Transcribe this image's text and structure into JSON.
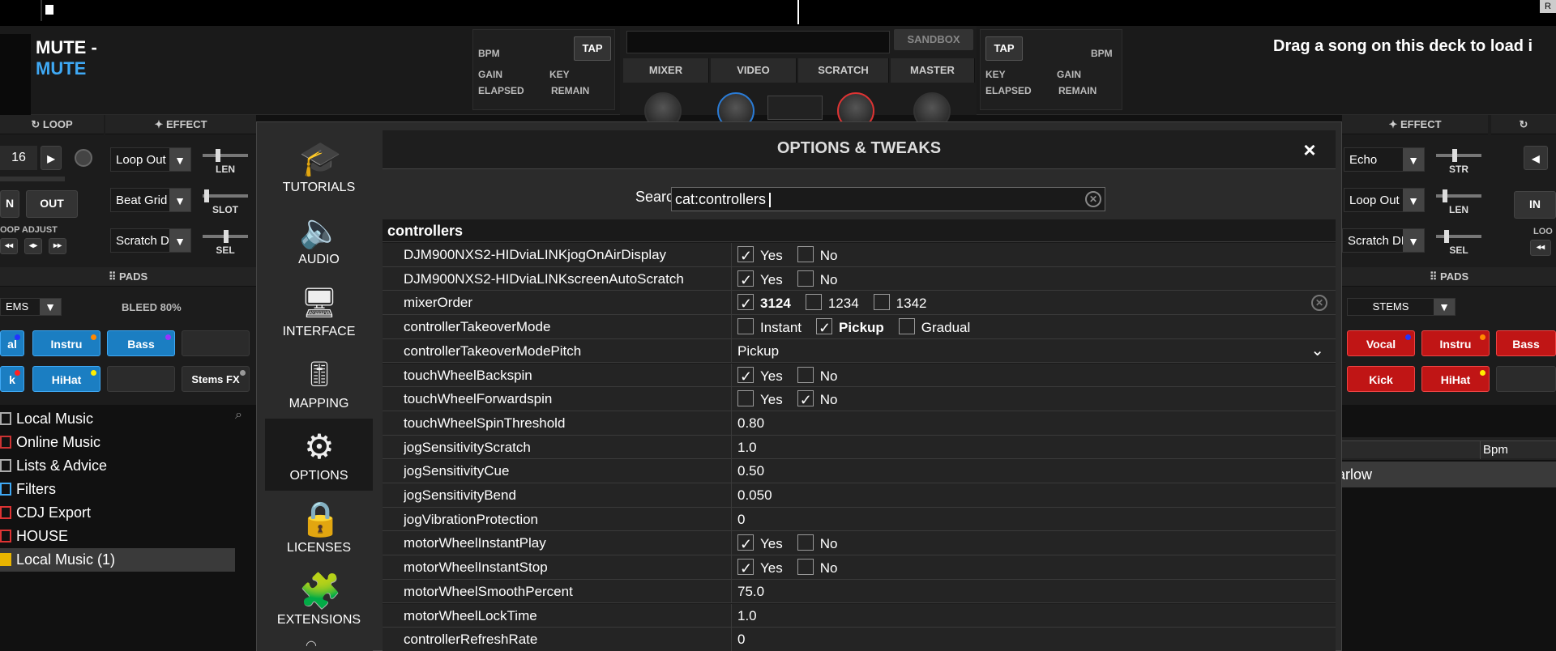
{
  "deck_left": {
    "title": "MUTE -",
    "subtitle": "MUTE",
    "bpm_label": "BPM",
    "tap_label": "TAP",
    "gain_label": "GAIN",
    "key_label": "KEY",
    "elapsed_label": "ELAPSED",
    "remain_label": "REMAIN",
    "loop_header": "LOOP",
    "effect_header": "EFFECT",
    "loop_size": "16",
    "in_label": "N",
    "out_label": "OUT",
    "loop_adjust": "OOP ADJUST",
    "effects": [
      "Loop Out",
      "Beat Grid",
      "Scratch DN"
    ],
    "slider_labels": [
      "LEN",
      "SLOT",
      "SEL"
    ],
    "pads_header": "PADS",
    "stems_select": "EMS",
    "bleed": "BLEED 80%",
    "pads": [
      "al",
      "Instru",
      "Bass",
      "",
      "k",
      "HiHat",
      "",
      "Stems FX"
    ]
  },
  "deck_right": {
    "title": "Drag a song on this deck to load i",
    "tap_label": "TAP",
    "bpm_label": "BPM",
    "key_label": "KEY",
    "gain_label": "GAIN",
    "elapsed_label": "ELAPSED",
    "remain_label": "REMAIN",
    "effect_header": "EFFECT",
    "effects": [
      "Echo",
      "Loop Out",
      "Scratch DN"
    ],
    "slider_labels": [
      "STR",
      "LEN",
      "SEL"
    ],
    "in_label": "IN",
    "loop_adjust": "LOO",
    "pads_header": "PADS",
    "stems_select": "STEMS",
    "pads": [
      "Vocal",
      "Instru",
      "Bass",
      "Kick",
      "HiHat",
      ""
    ],
    "col_bpm": "Bpm",
    "track_partial": "arlow"
  },
  "center": {
    "sandbox": "SANDBOX",
    "tabs": [
      "MIXER",
      "VIDEO",
      "SCRATCH",
      "MASTER"
    ]
  },
  "browser": {
    "items": [
      "Local Music",
      "Online Music",
      "Lists & Advice",
      "Filters",
      "CDJ Export",
      "HOUSE",
      "Local Music (1)"
    ]
  },
  "dialog": {
    "title": "OPTIONS & TWEAKS",
    "close": "×",
    "search_label": "Search:",
    "search_value": "cat:controllers",
    "nav": [
      "TUTORIALS",
      "AUDIO",
      "INTERFACE",
      "MAPPING",
      "OPTIONS",
      "LICENSES",
      "EXTENSIONS"
    ],
    "group": "controllers",
    "rows": [
      {
        "name": "DJM900NXS2-HIDviaLINKjogOnAirDisplay",
        "type": "yesno",
        "value": "Yes"
      },
      {
        "name": "DJM900NXS2-HIDviaLINKscreenAutoScratch",
        "type": "yesno",
        "value": "Yes"
      },
      {
        "name": "mixerOrder",
        "type": "multi",
        "options": [
          "3124",
          "1234",
          "1342"
        ],
        "value": "3124"
      },
      {
        "name": "controllerTakeoverMode",
        "type": "multi",
        "options": [
          "Instant",
          "Pickup",
          "Gradual"
        ],
        "value": "Pickup"
      },
      {
        "name": "controllerTakeoverModePitch",
        "type": "select",
        "value": "Pickup"
      },
      {
        "name": "touchWheelBackspin",
        "type": "yesno",
        "value": "Yes"
      },
      {
        "name": "touchWheelForwardspin",
        "type": "yesno",
        "value": "No"
      },
      {
        "name": "touchWheelSpinThreshold",
        "type": "text",
        "value": "0.80"
      },
      {
        "name": "jogSensitivityScratch",
        "type": "text",
        "value": "1.0"
      },
      {
        "name": "jogSensitivityCue",
        "type": "text",
        "value": "0.50"
      },
      {
        "name": "jogSensitivityBend",
        "type": "text",
        "value": "0.050"
      },
      {
        "name": "jogVibrationProtection",
        "type": "text",
        "value": "0"
      },
      {
        "name": "motorWheelInstantPlay",
        "type": "yesno",
        "value": "Yes"
      },
      {
        "name": "motorWheelInstantStop",
        "type": "yesno",
        "value": "Yes"
      },
      {
        "name": "motorWheelSmoothPercent",
        "type": "text",
        "value": "75.0"
      },
      {
        "name": "motorWheelLockTime",
        "type": "text",
        "value": "1.0"
      },
      {
        "name": "controllerRefreshRate",
        "type": "text",
        "value": "0"
      }
    ],
    "yes": "Yes",
    "no": "No"
  }
}
